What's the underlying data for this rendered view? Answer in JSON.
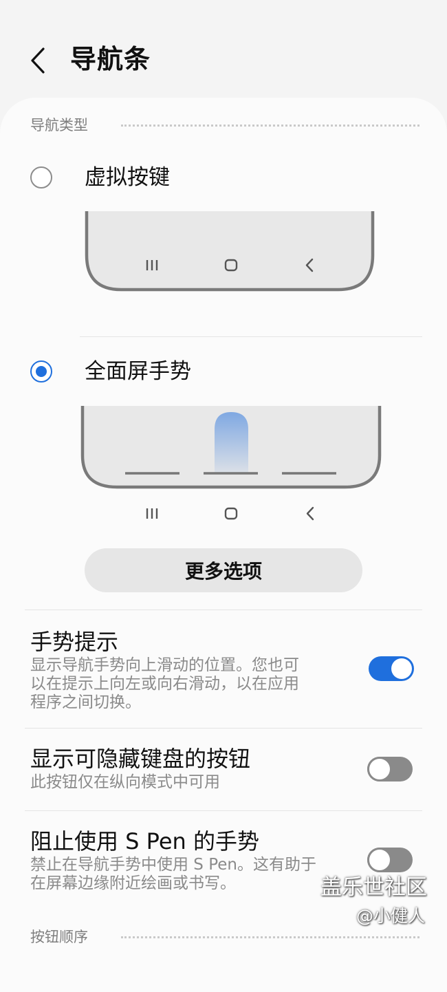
{
  "header": {
    "title": "导航条"
  },
  "nav_type": {
    "section_label": "导航类型",
    "options": [
      {
        "label": "虚拟按键",
        "selected": false
      },
      {
        "label": "全面屏手势",
        "selected": true
      }
    ],
    "more_options_label": "更多选项"
  },
  "settings": [
    {
      "title": "手势提示",
      "description_lines": [
        "显示导航手势向上滑动的位置。您也可",
        "以在提示上向左或向右滑动，以在应用",
        "程序之间切换。"
      ],
      "enabled": true
    },
    {
      "title": "显示可隐藏键盘的按钮",
      "description_lines": [
        "此按钮仅在纵向模式中可用"
      ],
      "enabled": false
    },
    {
      "title": "阻止使用 S Pen 的手势",
      "description_lines": [
        "禁止在导航手势中使用 S Pen。这有助于",
        "在屏幕边缘附近绘画或书写。"
      ],
      "enabled": false
    }
  ],
  "button_order": {
    "section_label": "按钮顺序"
  },
  "watermark": {
    "text": "盖乐世社区",
    "sub": "@小健人"
  },
  "colors": {
    "accent": "#1f6fdd",
    "background": "#f4f4f4",
    "card": "#fbfbfb",
    "toggle_off": "#8a8a8a"
  },
  "icons": {
    "back": "chevron-left-icon",
    "recents": "recents-icon",
    "home": "home-icon",
    "nav_back": "nav-back-icon"
  }
}
